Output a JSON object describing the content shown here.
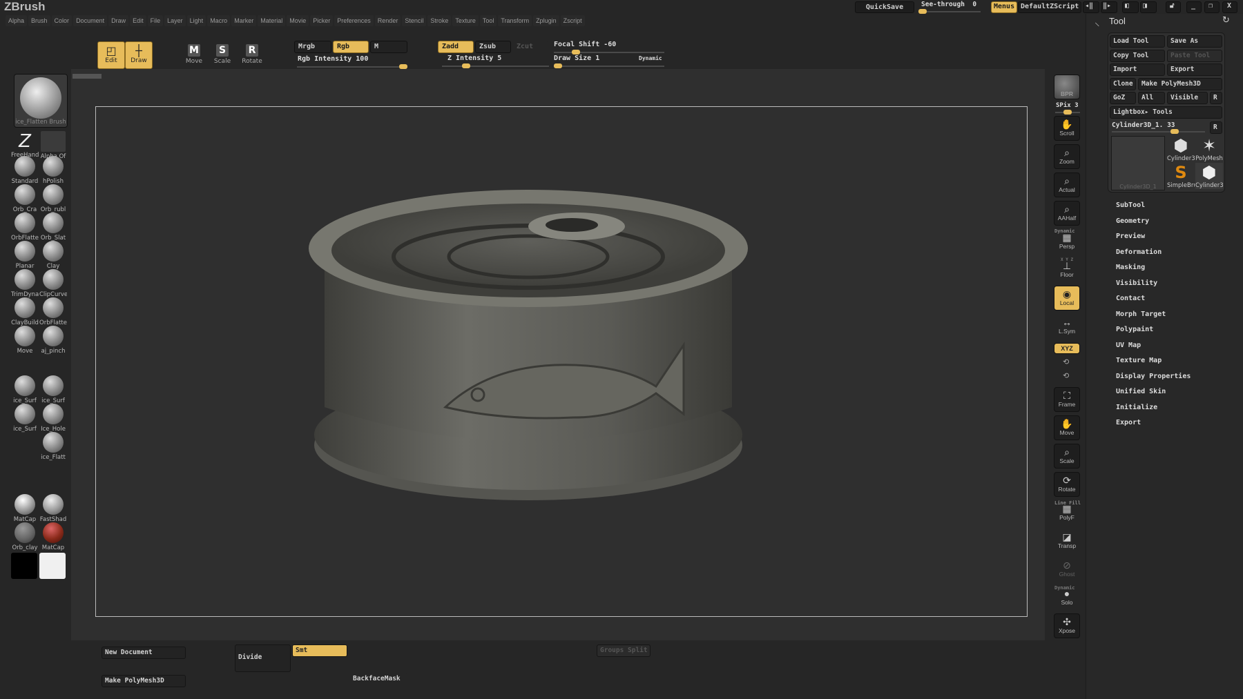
{
  "app": {
    "title": "ZBrush"
  },
  "menus": [
    "Alpha",
    "Brush",
    "Color",
    "Document",
    "Draw",
    "Edit",
    "File",
    "Layer",
    "Light",
    "Macro",
    "Marker",
    "Material",
    "Movie",
    "Picker",
    "Preferences",
    "Render",
    "Stencil",
    "Stroke",
    "Texture",
    "Tool",
    "Transform",
    "Zplugin",
    "Zscript"
  ],
  "topright": {
    "quicksave": "QuickSave",
    "seethrough": "See-through",
    "seethrough_value": "0",
    "seethrough_level": 0,
    "menus": "Menus",
    "script": "DefaultZScript"
  },
  "toolbar": {
    "edit": "Edit",
    "draw": "Draw",
    "move": "Move",
    "scale": "Scale",
    "rotate": "Rotate",
    "move_g": "M",
    "scale_g": "S",
    "rotate_g": "R",
    "mrgb": "Mrgb",
    "rgb": "Rgb",
    "m": "M",
    "rgb_intensity": "Rgb Intensity 100",
    "rgb_intensity_value": 100,
    "zadd": "Zadd",
    "zsub": "Zsub",
    "zcut": "Zcut",
    "z_intensity": "Z Intensity 5",
    "z_intensity_value": 5,
    "focal_shift": "Focal Shift -60",
    "focal_shift_value": -60,
    "draw_size": "Draw Size 1",
    "draw_size_value": 1,
    "dynamic": "Dynamic"
  },
  "left_shelf": {
    "current_brush": "ice_Flatten Brush",
    "stroke": "FreeHand",
    "alpha": "Alpha Of",
    "brushes": [
      "Standard",
      "hPolish",
      "Orb_Cra",
      "Orb_rubl",
      "OrbFlatte",
      "Orb_Slat",
      "Planar",
      "Clay",
      "TrimDyna",
      "ClipCurve",
      "ClayBuild",
      "OrbFlatte",
      "Move",
      "aj_pinch"
    ],
    "custom_brushes": [
      "ice_Surf",
      "ice_Surf",
      "ice_Surf",
      "Ice_Hole",
      "ice_Flatt"
    ],
    "materials": [
      "MatCap",
      "FastShad",
      "Orb_clay",
      "MatCap"
    ],
    "colors": {
      "primary": "#000000",
      "secondary": "#f0f0f0"
    }
  },
  "right_shelf": {
    "bpr": "BPR",
    "spix": "SPix 3",
    "items": [
      "Scroll",
      "Zoom",
      "Actual",
      "AAHalf",
      "Persp",
      "Floor",
      "Local",
      "L.Sym",
      "XYZ",
      "Frame",
      "Move",
      "Scale",
      "Rotate",
      "PolyF",
      "Transp",
      "Ghost",
      "Solo",
      "Xpose"
    ],
    "persp_top": "Dynamic",
    "polyf_top": "Line Fill",
    "solo_top": "Dynamic",
    "floor_axes": "X Y Z"
  },
  "tool_panel": {
    "title": "Tool",
    "load": "Load Tool",
    "save_as": "Save As",
    "copy": "Copy Tool",
    "paste": "Paste Tool",
    "import": "Import",
    "export": "Export",
    "clone": "Clone",
    "make_polymesh": "Make PolyMesh3D",
    "goz": "GoZ",
    "all": "All",
    "visible": "Visible",
    "r": "R",
    "lightbox": "Lightbox▸ Tools",
    "current_tool": "Cylinder3D_1. 33",
    "current_tool_value": 33,
    "thumbs": [
      "Cylinder3D_1",
      "Cylinder3",
      "PolyMesh",
      "SimpleBru",
      "Cylinder3"
    ],
    "subpalettes": [
      "SubTool",
      "Geometry",
      "Preview",
      "Deformation",
      "Masking",
      "Visibility",
      "Contact",
      "Morph Target",
      "Polypaint",
      "UV Map",
      "Texture Map",
      "Display Properties",
      "Unified Skin",
      "Initialize",
      "Export"
    ]
  },
  "bottom": {
    "new_document": "New Document",
    "make_polymesh": "Make PolyMesh3D",
    "divide": "Divide",
    "smt": "Smt",
    "backface": "BackfaceMask",
    "groups_split": "Groups Split"
  },
  "colors": {
    "accent": "#e7bc5a",
    "bg": "#262626",
    "canvas": "#2f2f2f"
  }
}
